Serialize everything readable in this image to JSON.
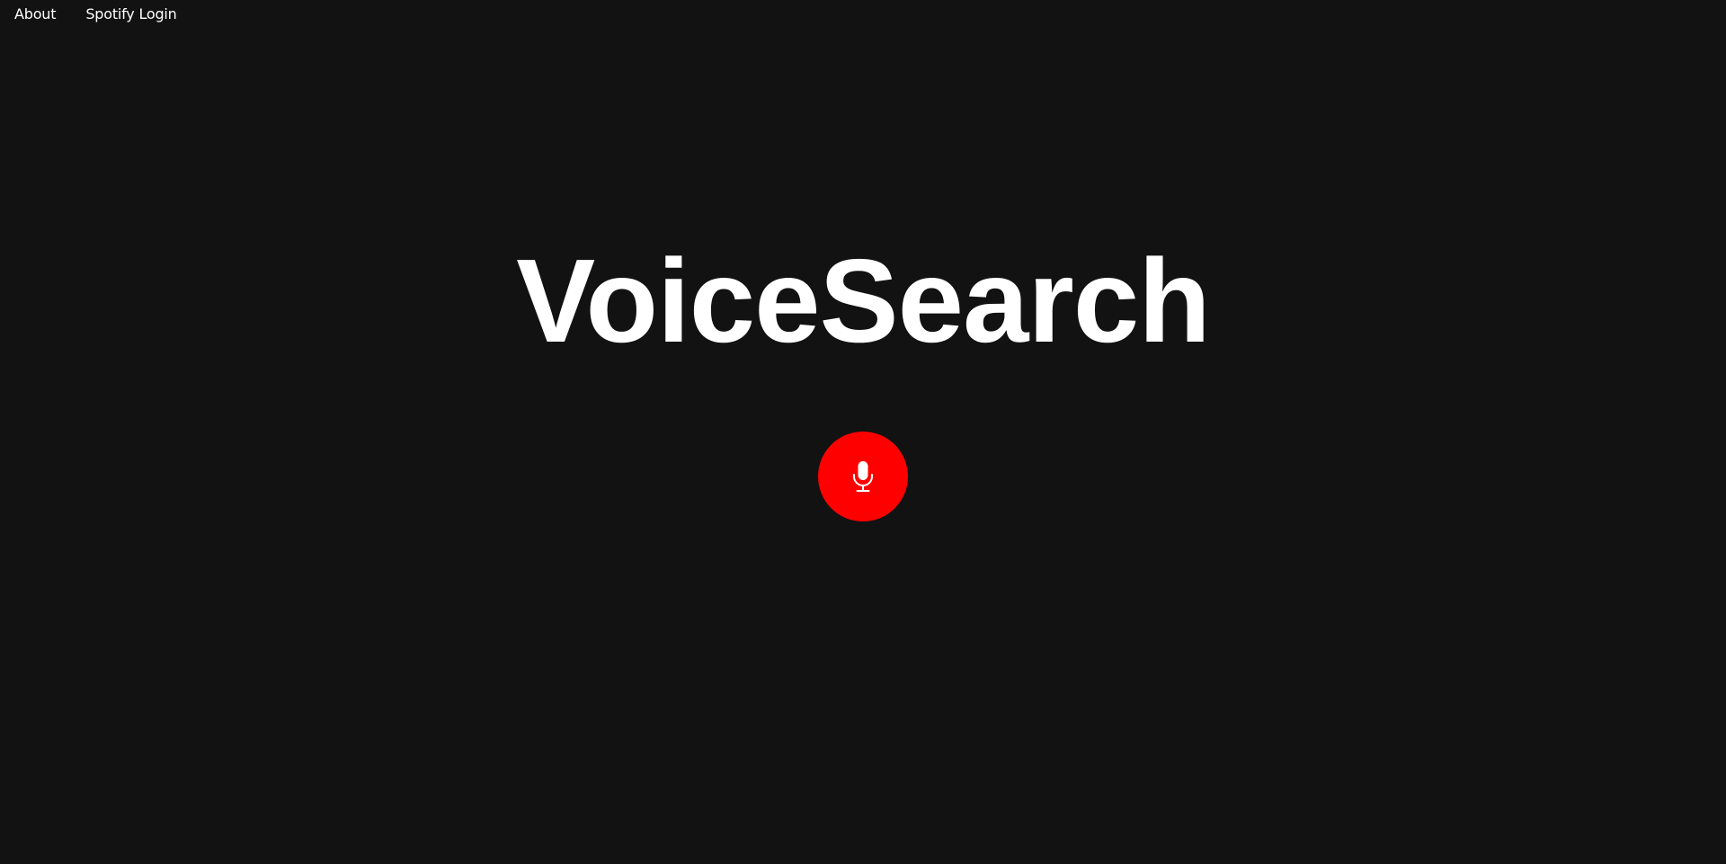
{
  "nav": {
    "items": [
      {
        "label": "About"
      },
      {
        "label": "Spotify Login"
      }
    ]
  },
  "main": {
    "title": "VoiceSearch",
    "mic_button": {
      "icon": "microphone-icon",
      "color": "#ff0000"
    }
  },
  "colors": {
    "background": "#121212",
    "text": "#ffffff",
    "accent": "#ff0000"
  }
}
